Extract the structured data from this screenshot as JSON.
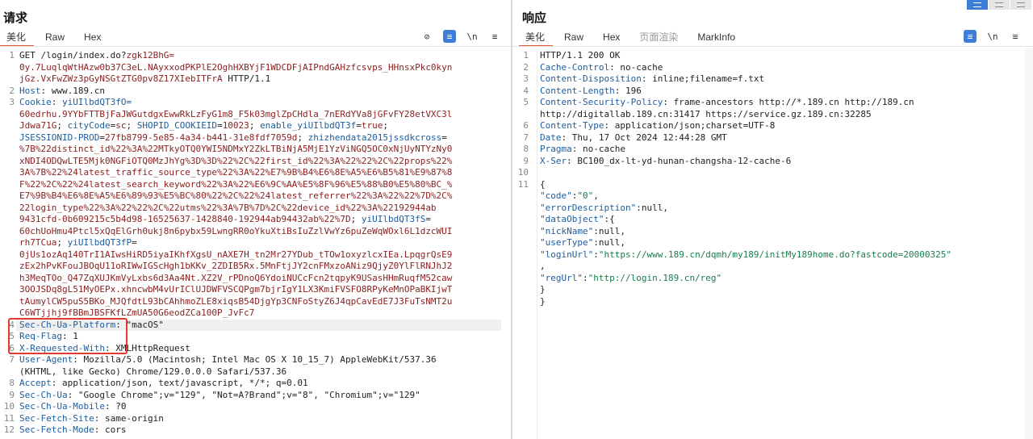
{
  "request": {
    "title": "请求",
    "tabs": [
      "美化",
      "Raw",
      "Hex"
    ],
    "active_tab": "美化",
    "tools": [
      {
        "icon": "eye-off-icon",
        "glyph": "⊘"
      },
      {
        "icon": "wrap-lines-icon",
        "glyph": "≡"
      },
      {
        "icon": "newline-toggle-icon",
        "glyph": "\\n"
      },
      {
        "icon": "menu-icon",
        "glyph": "≡"
      }
    ],
    "lines": [
      {
        "n": "1",
        "segs": [
          {
            "t": "GET /login/index.do?"
          },
          {
            "t": "zgk12BhG=",
            "c": "v"
          }
        ]
      },
      {
        "n": "",
        "segs": [
          {
            "t": "0y.7LuqlqWtHAzw0b37C3eL.NAyxxodPKPlE2OghHXBYjF1WDCDFjAIPndGAHzfcsvps_HHnsxPkc0kyn",
            "c": "v"
          }
        ]
      },
      {
        "n": "",
        "segs": [
          {
            "t": "jGz.VxFwZWz3pGyNSGtZTG0pv8Z17XIebITFrA",
            "c": "v"
          },
          {
            "t": " HTTP/1.1"
          }
        ]
      },
      {
        "n": "2",
        "segs": [
          {
            "t": "Host",
            "c": "k"
          },
          {
            "t": ": www.189.cn"
          }
        ]
      },
      {
        "n": "3",
        "segs": [
          {
            "t": "Cookie",
            "c": "k"
          },
          {
            "t": ": "
          },
          {
            "t": "yiUIlbdQT3fO=",
            "c": "k"
          }
        ]
      },
      {
        "n": "",
        "segs": [
          {
            "t": "60edrhu.9YYbFTTBjFaJWGutdgxEwwRkLzFyG1m8_F5k03mglZpCHdla_7nERdYVa8jGFvFY28etVXC3l",
            "c": "v"
          }
        ]
      },
      {
        "n": "",
        "segs": [
          {
            "t": "Jdwa71G",
            "c": "v"
          },
          {
            "t": "; "
          },
          {
            "t": "cityCode",
            "c": "k"
          },
          {
            "t": "="
          },
          {
            "t": "sc",
            "c": "v"
          },
          {
            "t": "; "
          },
          {
            "t": "SHOPID_COOKIEID",
            "c": "k"
          },
          {
            "t": "="
          },
          {
            "t": "10023",
            "c": "v"
          },
          {
            "t": "; "
          },
          {
            "t": "enable_yiUIlbdQT3f",
            "c": "k"
          },
          {
            "t": "="
          },
          {
            "t": "true",
            "c": "v"
          },
          {
            "t": ";"
          }
        ]
      },
      {
        "n": "",
        "segs": [
          {
            "t": "JSESSIONID-PROD",
            "c": "k"
          },
          {
            "t": "="
          },
          {
            "t": "27fb8799-5e85-4a34-b441-31e8fdf7059d",
            "c": "v"
          },
          {
            "t": "; "
          },
          {
            "t": "zhizhendata2015jssdkcross",
            "c": "k"
          },
          {
            "t": "="
          }
        ]
      },
      {
        "n": "",
        "segs": [
          {
            "t": "%7B%22distinct_id%22%3A%22MTkyOTQ0YWI5NDMxY2ZkLTBiNjA5MjE1YzViNGQ5OC0xNjUyNTYzNy0",
            "c": "v"
          }
        ]
      },
      {
        "n": "",
        "segs": [
          {
            "t": "xNDI4ODQwLTE5Mjk0NGFiOTQ0MzJhYg%3D%3D%22%2C%22first_id%22%3A%22%22%2C%22props%22%",
            "c": "v"
          }
        ]
      },
      {
        "n": "",
        "segs": [
          {
            "t": "3A%7B%22%24latest_traffic_source_type%22%3A%22%E7%9B%B4%E6%8E%A5%E6%B5%81%E9%87%8",
            "c": "v"
          }
        ]
      },
      {
        "n": "",
        "segs": [
          {
            "t": "F%22%2C%22%24latest_search_keyword%22%3A%22%E6%9C%AA%E5%8F%96%E5%88%B0%E5%80%BC_%",
            "c": "v"
          }
        ]
      },
      {
        "n": "",
        "segs": [
          {
            "t": "E7%9B%B4%E6%8E%A5%E6%89%93%E5%BC%80%22%2C%22%24latest_referrer%22%3A%22%22%7D%2C%",
            "c": "v"
          }
        ]
      },
      {
        "n": "",
        "segs": [
          {
            "t": "22login_type%22%3A%22%22%2C%22utms%22%3A%7B%7D%2C%22device_id%22%3A%22192944ab",
            "c": "v"
          }
        ]
      },
      {
        "n": "",
        "segs": [
          {
            "t": "9431cfd-0b609215c5b4d98-16525637-1428840-192944ab94432ab%22%7D",
            "c": "v"
          },
          {
            "t": "; "
          },
          {
            "t": "yiUIlbdQT3fS",
            "c": "k"
          },
          {
            "t": "="
          }
        ]
      },
      {
        "n": "",
        "segs": [
          {
            "t": "60chUoHmu4Ptcl5xQqElGrh0ukj8n6pybx59LwngRR0oYkuXtiBsIuZzlVwYz6puZeWqWOxl6L1dzcWUI",
            "c": "v"
          }
        ]
      },
      {
        "n": "",
        "segs": [
          {
            "t": "rh7TCua",
            "c": "v"
          },
          {
            "t": "; "
          },
          {
            "t": "yiUIlbdQT3fP",
            "c": "k"
          },
          {
            "t": "="
          }
        ]
      },
      {
        "n": "",
        "segs": [
          {
            "t": "0jUs1ozAq140TrI1AIwsHiRD5iyaIKhfXgsU_nAXE7H_tn2Mr27YDub_tTOw1oxyzlcxIEa.LpqgrQsE9",
            "c": "v"
          }
        ]
      },
      {
        "n": "",
        "segs": [
          {
            "t": "zEx2hPvKFouJBOqU11oRIWwIGScHgh1bKKv_2ZDIB5Rx.5MnFtjJY2cnFMxzoANiz9QjyZ0YlFlRNJhJ2",
            "c": "v"
          }
        ]
      },
      {
        "n": "",
        "segs": [
          {
            "t": "h3MeqTOo_Q47ZqXUJKmVyLxbs6d3Aa4Nt.XZ2V_rPDnoQ6YdoiNUCcFcn2tqpyK9USasHHmRuqfM52caw",
            "c": "v"
          }
        ]
      },
      {
        "n": "",
        "segs": [
          {
            "t": "3OOJSDq8gL51MyOEPx.xhncwbM4vUrIClUJDWFVSCQPgm7bjrIgY1LX3KmiFVSFO8RPyKeMnOPaBKIjwT",
            "c": "v"
          }
        ]
      },
      {
        "n": "",
        "segs": [
          {
            "t": "tAumylCW5puS5BKo_MJQfdtL93bCAhhmoZLE8xiqsB54DjgYp3CNFoStyZ6J4qpCavEdE7J3FuTsNMT2u",
            "c": "v"
          }
        ]
      },
      {
        "n": "",
        "segs": [
          {
            "t": "C6WTjjhj9fBBmJBSFKfLZmUA50G6eodZCa100P_JvFc7",
            "c": "v"
          }
        ]
      },
      {
        "n": "4",
        "segs": [
          {
            "t": "Sec-Ch-Ua-Platform",
            "c": "k"
          },
          {
            "t": ": \"macOS\""
          }
        ]
      },
      {
        "n": "5",
        "segs": [
          {
            "t": "Req-Flag",
            "c": "k"
          },
          {
            "t": ": 1"
          }
        ]
      },
      {
        "n": "6",
        "segs": [
          {
            "t": "X-Requested-With",
            "c": "k"
          },
          {
            "t": ": XMLHttpRequest"
          }
        ]
      },
      {
        "n": "7",
        "segs": [
          {
            "t": "User-Agent",
            "c": "k"
          },
          {
            "t": ": Mozilla/5.0 (Macintosh; Intel Mac OS X 10_15_7) AppleWebKit/537.36"
          }
        ]
      },
      {
        "n": "",
        "segs": [
          {
            "t": "(KHTML, like Gecko) Chrome/129.0.0.0 Safari/537.36"
          }
        ]
      },
      {
        "n": "8",
        "segs": [
          {
            "t": "Accept",
            "c": "k"
          },
          {
            "t": ": application/json, text/javascript, */*; q=0.01"
          }
        ]
      },
      {
        "n": "9",
        "segs": [
          {
            "t": "Sec-Ch-Ua",
            "c": "k"
          },
          {
            "t": ": \"Google Chrome\";v=\"129\", \"Not=A?Brand\";v=\"8\", \"Chromium\";v=\"129\""
          }
        ]
      },
      {
        "n": "10",
        "segs": [
          {
            "t": "Sec-Ch-Ua-Mobile",
            "c": "k"
          },
          {
            "t": ": ?0"
          }
        ]
      },
      {
        "n": "11",
        "segs": [
          {
            "t": "Sec-Fetch-Site",
            "c": "k"
          },
          {
            "t": ": same-origin"
          }
        ]
      },
      {
        "n": "12",
        "segs": [
          {
            "t": "Sec-Fetch-Mode",
            "c": "k"
          },
          {
            "t": ": cors"
          }
        ]
      }
    ]
  },
  "response": {
    "title": "响应",
    "tabs": [
      "美化",
      "Raw",
      "Hex",
      "页面渲染",
      "MarkInfo"
    ],
    "active_tab": "美化",
    "tools": [
      {
        "icon": "wrap-lines-icon",
        "glyph": "≡"
      },
      {
        "icon": "newline-toggle-icon",
        "glyph": "\\n"
      },
      {
        "icon": "menu-icon",
        "glyph": "≡"
      }
    ],
    "lines": [
      {
        "n": "1",
        "segs": [
          {
            "t": "HTTP/1.1 200 OK"
          }
        ]
      },
      {
        "n": "2",
        "segs": [
          {
            "t": "Cache-Control",
            "c": "k"
          },
          {
            "t": ": no-cache"
          }
        ]
      },
      {
        "n": "3",
        "segs": [
          {
            "t": "Content-Disposition",
            "c": "k"
          },
          {
            "t": ": inline;filename=f.txt"
          }
        ]
      },
      {
        "n": "4",
        "segs": [
          {
            "t": "Content-Length",
            "c": "k"
          },
          {
            "t": ": 196"
          }
        ]
      },
      {
        "n": "5",
        "segs": [
          {
            "t": "Content-Security-Policy",
            "c": "k"
          },
          {
            "t": ": frame-ancestors http://*.189.cn http://189.cn"
          }
        ]
      },
      {
        "n": "",
        "segs": [
          {
            "t": "http://digitallab.189.cn:31417 https://service.gz.189.cn:32285"
          }
        ]
      },
      {
        "n": "6",
        "segs": [
          {
            "t": "Content-Type",
            "c": "k"
          },
          {
            "t": ": application/json;charset=UTF-8"
          }
        ]
      },
      {
        "n": "7",
        "segs": [
          {
            "t": "Date",
            "c": "k"
          },
          {
            "t": ": Thu, 17 Oct 2024 12:44:28 GMT"
          }
        ]
      },
      {
        "n": "8",
        "segs": [
          {
            "t": "Pragma",
            "c": "k"
          },
          {
            "t": ": no-cache"
          }
        ]
      },
      {
        "n": "9",
        "segs": [
          {
            "t": "X-Ser",
            "c": "k"
          },
          {
            "t": ": BC100_dx-lt-yd-hunan-changsha-12-cache-6"
          }
        ]
      },
      {
        "n": "10",
        "segs": []
      },
      {
        "n": "11",
        "segs": [
          {
            "t": "{"
          }
        ]
      },
      {
        "n": "",
        "segs": [
          {
            "t": "  "
          },
          {
            "t": "\"code\"",
            "c": "k"
          },
          {
            "t": ":"
          },
          {
            "t": "\"0\"",
            "c": "s"
          },
          {
            "t": ","
          }
        ]
      },
      {
        "n": "",
        "segs": [
          {
            "t": "  "
          },
          {
            "t": "\"errorDescription\"",
            "c": "k"
          },
          {
            "t": ":null,"
          }
        ]
      },
      {
        "n": "",
        "segs": [
          {
            "t": "  "
          },
          {
            "t": "\"dataObject\"",
            "c": "k"
          },
          {
            "t": ":{"
          }
        ]
      },
      {
        "n": "",
        "segs": [
          {
            "t": "    "
          },
          {
            "t": "\"nickName\"",
            "c": "k"
          },
          {
            "t": ":null,"
          }
        ]
      },
      {
        "n": "",
        "segs": [
          {
            "t": "    "
          },
          {
            "t": "\"userType\"",
            "c": "k"
          },
          {
            "t": ":null,"
          }
        ]
      },
      {
        "n": "",
        "segs": [
          {
            "t": "    "
          },
          {
            "t": "\"loginUrl\"",
            "c": "k"
          },
          {
            "t": ":"
          },
          {
            "t": "\"https://www.189.cn/dqmh/my189/initMy189home.do?fastcode=20000325\"",
            "c": "s"
          }
        ]
      },
      {
        "n": "",
        "segs": [
          {
            "t": "    ,"
          }
        ]
      },
      {
        "n": "",
        "segs": [
          {
            "t": "    "
          },
          {
            "t": "\"regUrl\"",
            "c": "k"
          },
          {
            "t": ":"
          },
          {
            "t": "\"http://login.189.cn/reg\"",
            "c": "s"
          }
        ]
      },
      {
        "n": "",
        "segs": [
          {
            "t": "  }"
          }
        ]
      },
      {
        "n": "",
        "segs": [
          {
            "t": "}"
          }
        ]
      }
    ]
  },
  "colors": {
    "accent": "#e0593a",
    "highlight_box": "#e23b2f",
    "key": "#1c5c9e",
    "value": "#8a1e1e",
    "string": "#17804a",
    "toolbar_blue": "#3d7ed8"
  }
}
